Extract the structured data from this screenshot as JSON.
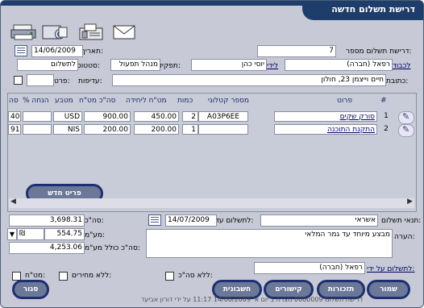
{
  "title": "דרישת תשלום חדשה",
  "toolbar": {
    "icons": [
      "mail-icon",
      "fax-icon",
      "email-icon",
      "print-icon"
    ]
  },
  "header": {
    "request_number_label": "דרישת תשלום מספר:",
    "request_number_value": "7",
    "date_label": "תאריך:",
    "date_value": "14/06/2009",
    "to_label": "לכבוד",
    "to_value": "רפאל (חברה)",
    "by_label": "לידי",
    "by_value": "יוסי כהן",
    "role_label": "תפקיד:",
    "role_value": "מנהל תפעול",
    "status_label": "סטטוס:",
    "status_value": "לתשלום",
    "address_label": "כתובת:",
    "address_value": "חיים וייצמן 23, חולון",
    "priority_label": "עדיפות:",
    "private_label": "פרטי:"
  },
  "table": {
    "headers": [
      "#",
      "פרוט",
      "מספר קטלוגי",
      "כמות",
      "מט\"ח ליחידה",
      "סה\"כ מט\"ח",
      "מטבע",
      "% הנחה",
      "סה"
    ],
    "rows": [
      {
        "num": "1",
        "detail": "סורק שקים",
        "catalog": "A03P6EE",
        "qty": "2",
        "unit": "450.00",
        "total": "900.00",
        "currency": "USD",
        "discount": "",
        "sum": "40"
      },
      {
        "num": "2",
        "detail": "התקנת התוכנה",
        "catalog": "",
        "qty": "1",
        "unit": "200.00",
        "total": "200.00",
        "currency": "NIS",
        "discount": "",
        "sum": "91"
      }
    ],
    "new_item_label": "פריט חדש"
  },
  "totals": {
    "total_label": "סה\"כ:",
    "total_value": "3,698.31",
    "vat_label": "מע\"מ:",
    "vat_value": "554.75",
    "vat_select": "₪",
    "grand_label": "סה\"כ כולל מע\"מ:",
    "grand_value": "4,253.06"
  },
  "terms": {
    "due_label": "לתשלום עד:",
    "due_value": "14/07/2009",
    "payment_label": "תנאי תשלום:",
    "payment_value": "אשראי",
    "note_label": "הערה:",
    "note_value": "מבצע מיוחד עד גמר המלאי",
    "paid_by_label": "לתשלום על ידי:",
    "paid_by_value": "רפאל (חברה)"
  },
  "checkboxes": {
    "vat": "מט\"ח:",
    "no_total": "ללא סה\"כ:",
    "no_prices": "ללא מחירים:"
  },
  "buttons": {
    "save": "שמור",
    "reminders": "תזכורות",
    "receipts": "קישורים",
    "invoice": "חשבונית",
    "close": "סגור"
  },
  "footer": "דרישת תשלום 0000009 נוצרה ב יום א' 14/06/2009 11:17 על ידי דורון אביעד",
  "colors": {
    "title_bg": "#1f3d6b",
    "panel_bg": "#c7cad6",
    "button": "#6c7898",
    "button_border": "#1f2f70"
  }
}
